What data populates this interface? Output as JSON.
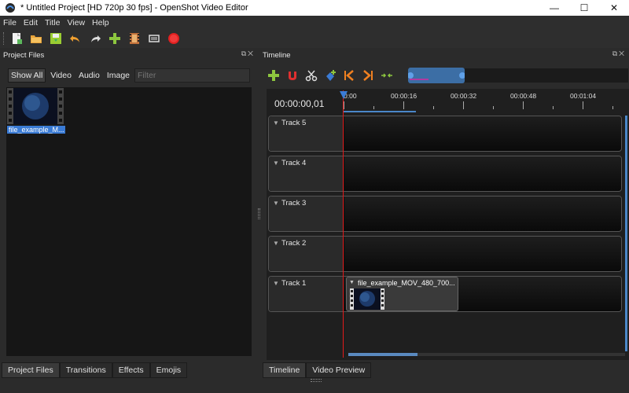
{
  "window": {
    "title": "* Untitled Project [HD 720p 30 fps] - OpenShot Video Editor",
    "minimize": "—",
    "maximize": "☐",
    "close": "✕"
  },
  "menu": [
    "File",
    "Edit",
    "Title",
    "View",
    "Help"
  ],
  "toolbar": {
    "icons": [
      "new-project-icon",
      "open-project-icon",
      "save-project-icon",
      "undo-icon",
      "redo-icon",
      "import-files-icon",
      "choose-profile-icon",
      "fullscreen-icon",
      "export-video-icon"
    ]
  },
  "project_files": {
    "header": "Project Files",
    "filters": [
      "Show All",
      "Video",
      "Audio",
      "Image"
    ],
    "active_filter": "Show All",
    "filter_placeholder": "Filter",
    "files": [
      {
        "label": "file_example_M..."
      }
    ]
  },
  "bottom_tabs_left": [
    "Project Files",
    "Transitions",
    "Effects",
    "Emojis"
  ],
  "timeline": {
    "header": "Timeline",
    "timecode": "00:00:00,01",
    "ruler_labels": [
      "0:00",
      "00:00:16",
      "00:00:32",
      "00:00:48",
      "00:01:04"
    ],
    "tracks": [
      {
        "name": "Track 5"
      },
      {
        "name": "Track 4"
      },
      {
        "name": "Track 3"
      },
      {
        "name": "Track 2"
      },
      {
        "name": "Track 1"
      }
    ],
    "clip": {
      "title": "file_example_MOV_480_700..."
    }
  },
  "bottom_tabs_right": [
    "Timeline",
    "Video Preview"
  ],
  "colors": {
    "accent": "#3a7bd5",
    "playhead": "#e21a1a"
  }
}
